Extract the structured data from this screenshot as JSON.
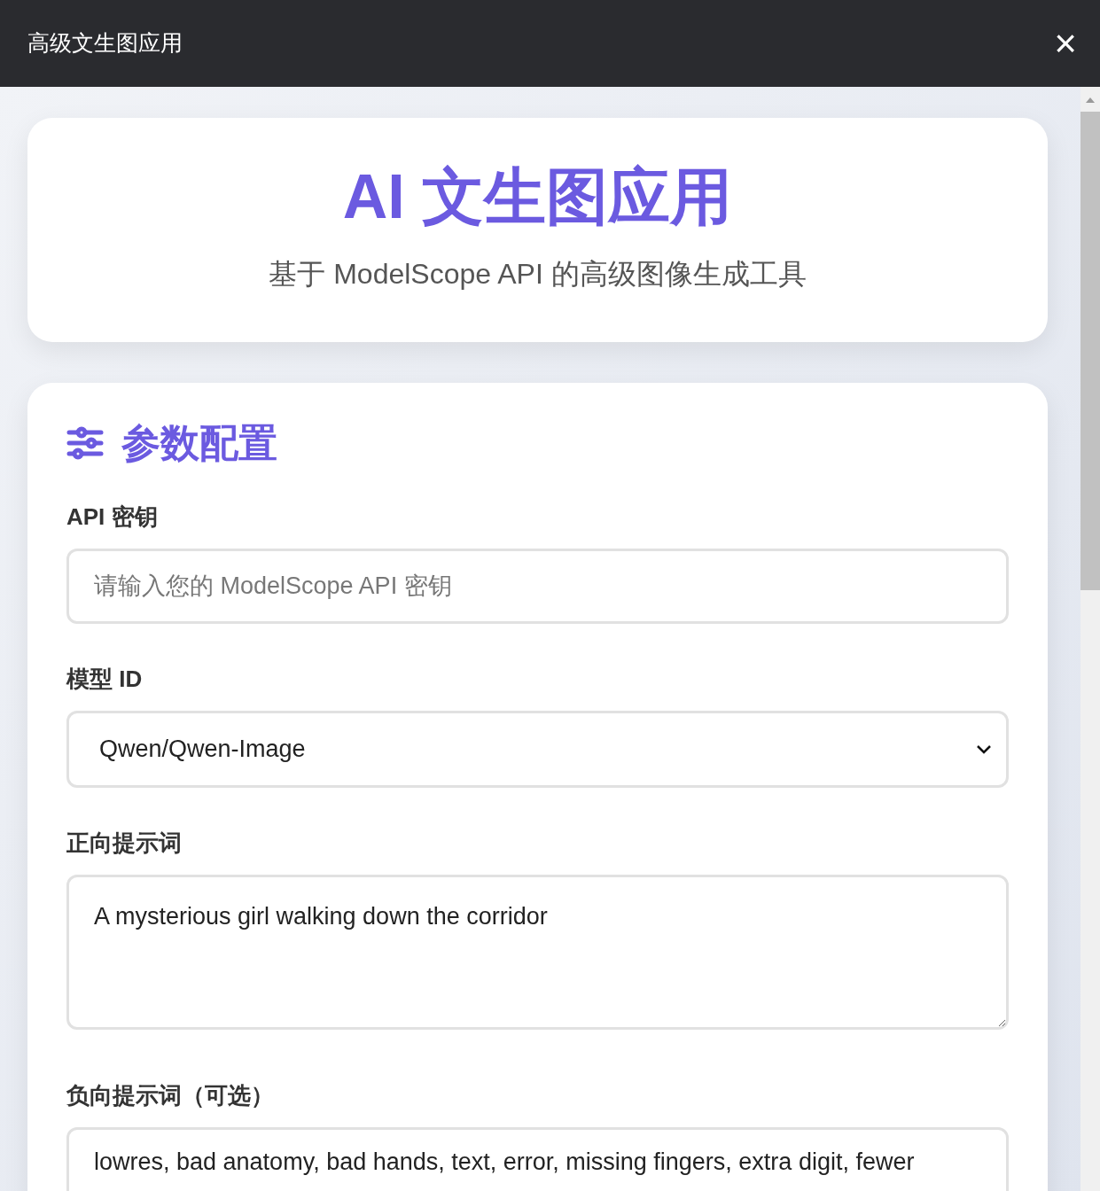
{
  "window": {
    "title": "高级文生图应用",
    "close": "×"
  },
  "hero": {
    "title": "AI 文生图应用",
    "subtitle": "基于 ModelScope API 的高级图像生成工具"
  },
  "config": {
    "heading": "参数配置",
    "api_key": {
      "label": "API 密钥",
      "placeholder": "请输入您的 ModelScope API 密钥"
    },
    "model": {
      "label": "模型 ID",
      "value": "Qwen/Qwen-Image"
    },
    "prompt": {
      "label": "正向提示词",
      "value": "A mysterious girl walking down the corridor"
    },
    "negative_prompt": {
      "label": "负向提示词（可选）",
      "value": "lowres, bad anatomy, bad hands, text, error, missing fingers, extra digit, fewer"
    }
  }
}
